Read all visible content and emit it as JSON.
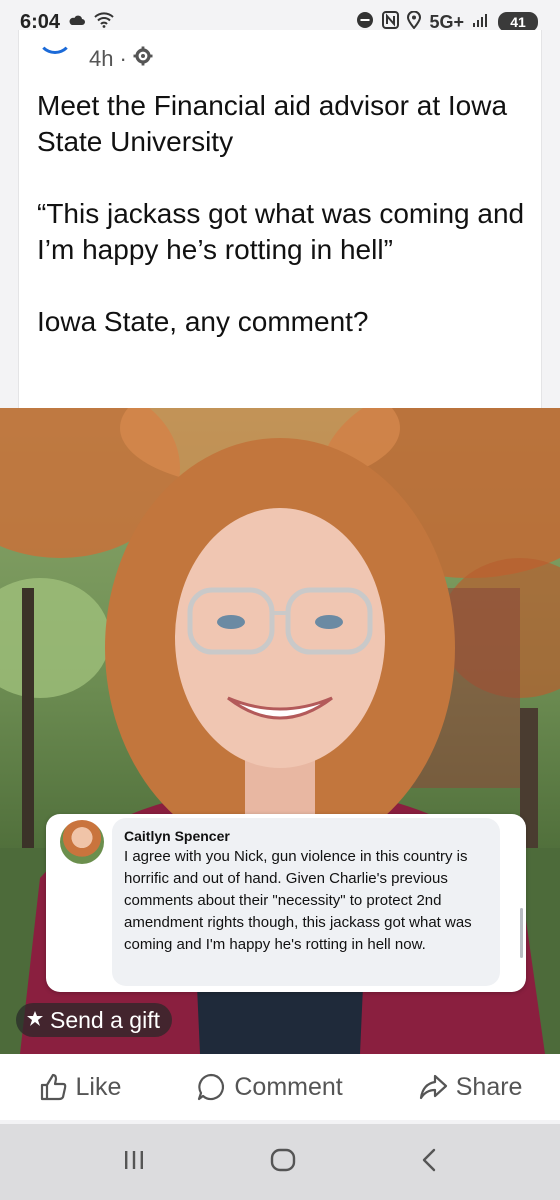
{
  "status_bar": {
    "time": "6:04",
    "network": "5G+",
    "battery": "41",
    "icons": [
      "weather-icon",
      "wifi-icon",
      "do-not-disturb-icon",
      "nfc-icon",
      "location-icon",
      "signal-icon",
      "battery-icon"
    ]
  },
  "post": {
    "time_ago": "4h",
    "separator": "·",
    "privacy_icon": "gear-icon",
    "paragraphs": [
      "Meet the Financial aid advisor at Iowa State University",
      "“This jackass got what was coming and I’m happy he’s rotting in hell”",
      "Iowa State, any comment?"
    ]
  },
  "comment": {
    "author": "Caitlyn Spencer",
    "body": "I agree with you Nick, gun violence in this country is horrific and out of hand. Given Charlie's previous comments about their \"necessity\" to protect 2nd amendment rights though, this jackass got what was coming and I'm happy he's rotting in hell now."
  },
  "gift": {
    "label": "Send a gift",
    "icon": "gift-icon"
  },
  "actions": {
    "like": "Like",
    "comment": "Comment",
    "share": "Share"
  },
  "nav": {
    "icons": [
      "recent-apps-icon",
      "home-icon",
      "back-icon"
    ]
  },
  "colors": {
    "accent": "#1b6ad8",
    "action_text": "#555555",
    "card_bg": "#ffffff"
  }
}
